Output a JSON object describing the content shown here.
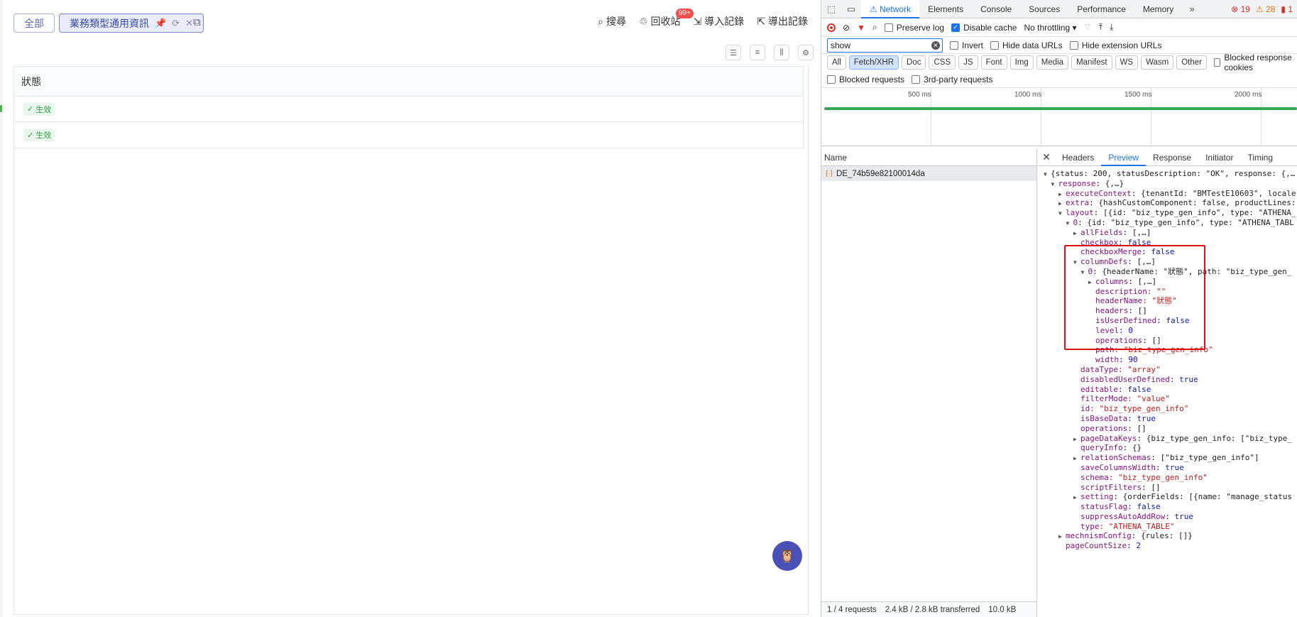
{
  "app": {
    "tabs": [
      {
        "label": "全部"
      },
      {
        "label": "業務類型通用資訊"
      }
    ],
    "toolbar": {
      "search": "搜尋",
      "recycle": "回收站",
      "recycle_badge": "99+",
      "import_log": "導入記錄",
      "export_log": "導出記錄"
    },
    "table": {
      "header": "狀態",
      "rows": [
        {
          "status": "生效"
        },
        {
          "status": "生效"
        }
      ]
    }
  },
  "devtools": {
    "tabs": [
      "Network",
      "Elements",
      "Console",
      "Sources",
      "Performance",
      "Memory"
    ],
    "active_tab": "Network",
    "errors": "19",
    "warnings": "28",
    "issues": "1",
    "controls": {
      "preserve_log": "Preserve log",
      "disable_cache": "Disable cache",
      "throttling": "No throttling"
    },
    "filter": {
      "value": "show",
      "invert": "Invert",
      "hide_data_urls": "Hide data URLs",
      "hide_extension_urls": "Hide extension URLs"
    },
    "type_filters": [
      "All",
      "Fetch/XHR",
      "Doc",
      "CSS",
      "JS",
      "Font",
      "Img",
      "Media",
      "Manifest",
      "WS",
      "Wasm",
      "Other"
    ],
    "active_type_filter": "Fetch/XHR",
    "blocked_response_cookies": "Blocked response cookies",
    "blocked_requests": "Blocked requests",
    "third_party": "3rd-party requests",
    "timeline_ticks": [
      "500 ms",
      "1000 ms",
      "1500 ms",
      "2000 ms"
    ],
    "name_header": "Name",
    "request_name": "DE_74b59e82100014da",
    "footer": {
      "requests": "1 / 4 requests",
      "transferred": "2.4 kB / 2.8 kB transferred",
      "resources": "10.0 kB"
    },
    "preview_tabs": [
      "Headers",
      "Preview",
      "Response",
      "Initiator",
      "Timing"
    ],
    "active_preview_tab": "Preview",
    "json_lines": [
      {
        "indent": 0,
        "arrow": "down",
        "text": "{status: 200, statusDescription: \"OK\", response: {,…"
      },
      {
        "indent": 1,
        "arrow": "down",
        "text": "response: {,…}"
      },
      {
        "indent": 2,
        "arrow": "right",
        "text": "executeContext: {tenantId: \"BMTestE10603\", locale"
      },
      {
        "indent": 2,
        "arrow": "right",
        "text": "extra: {hashCustomComponent: false, productLines:"
      },
      {
        "indent": 2,
        "arrow": "down",
        "text": "layout: [{id: \"biz_type_gen_info\", type: \"ATHENA_"
      },
      {
        "indent": 3,
        "arrow": "down",
        "text": "0: {id: \"biz_type_gen_info\", type: \"ATHENA_TABL"
      },
      {
        "indent": 4,
        "arrow": "right",
        "text": "allFields: [,…]"
      },
      {
        "indent": 4,
        "arrow": "",
        "text": "checkbox: false"
      },
      {
        "indent": 4,
        "arrow": "",
        "text": "checkboxMerge: false"
      },
      {
        "indent": 4,
        "arrow": "down",
        "text": "columnDefs: [,…]"
      },
      {
        "indent": 5,
        "arrow": "down",
        "text": "0: {headerName: \"狀態\", path: \"biz_type_gen_"
      },
      {
        "indent": 6,
        "arrow": "right",
        "text": "columns: [,…]"
      },
      {
        "indent": 6,
        "arrow": "",
        "text": "description: \"\""
      },
      {
        "indent": 6,
        "arrow": "",
        "text": "headerName: \"狀態\""
      },
      {
        "indent": 6,
        "arrow": "",
        "text": "headers: []"
      },
      {
        "indent": 6,
        "arrow": "",
        "text": "isUserDefined: false"
      },
      {
        "indent": 6,
        "arrow": "",
        "text": "level: 0"
      },
      {
        "indent": 6,
        "arrow": "",
        "text": "operations: []"
      },
      {
        "indent": 6,
        "arrow": "",
        "text": "path: \"biz_type_gen_info\""
      },
      {
        "indent": 6,
        "arrow": "",
        "text": "width: 90"
      },
      {
        "indent": 4,
        "arrow": "",
        "text": "dataType: \"array\""
      },
      {
        "indent": 4,
        "arrow": "",
        "text": "disabledUserDefined: true"
      },
      {
        "indent": 4,
        "arrow": "",
        "text": "editable: false"
      },
      {
        "indent": 4,
        "arrow": "",
        "text": "filterMode: \"value\""
      },
      {
        "indent": 4,
        "arrow": "",
        "text": "id: \"biz_type_gen_info\""
      },
      {
        "indent": 4,
        "arrow": "",
        "text": "isBaseData: true"
      },
      {
        "indent": 4,
        "arrow": "",
        "text": "operations: []"
      },
      {
        "indent": 4,
        "arrow": "right",
        "text": "pageDataKeys: {biz_type_gen_info: [\"biz_type_"
      },
      {
        "indent": 4,
        "arrow": "",
        "text": "queryInfo: {}"
      },
      {
        "indent": 4,
        "arrow": "right",
        "text": "relationSchemas: [\"biz_type_gen_info\"]"
      },
      {
        "indent": 4,
        "arrow": "",
        "text": "saveColumnsWidth: true"
      },
      {
        "indent": 4,
        "arrow": "",
        "text": "schema: \"biz_type_gen_info\""
      },
      {
        "indent": 4,
        "arrow": "",
        "text": "scriptFilters: []"
      },
      {
        "indent": 4,
        "arrow": "right",
        "text": "setting: {orderFields: [{name: \"manage_status"
      },
      {
        "indent": 4,
        "arrow": "",
        "text": "statusFlag: false"
      },
      {
        "indent": 4,
        "arrow": "",
        "text": "suppressAutoAddRow: true"
      },
      {
        "indent": 4,
        "arrow": "",
        "text": "type: \"ATHENA_TABLE\""
      },
      {
        "indent": 2,
        "arrow": "right",
        "text": "mechnismConfig: {rules: []}"
      },
      {
        "indent": 2,
        "arrow": "",
        "text": "pageCountSize: 2"
      }
    ]
  }
}
